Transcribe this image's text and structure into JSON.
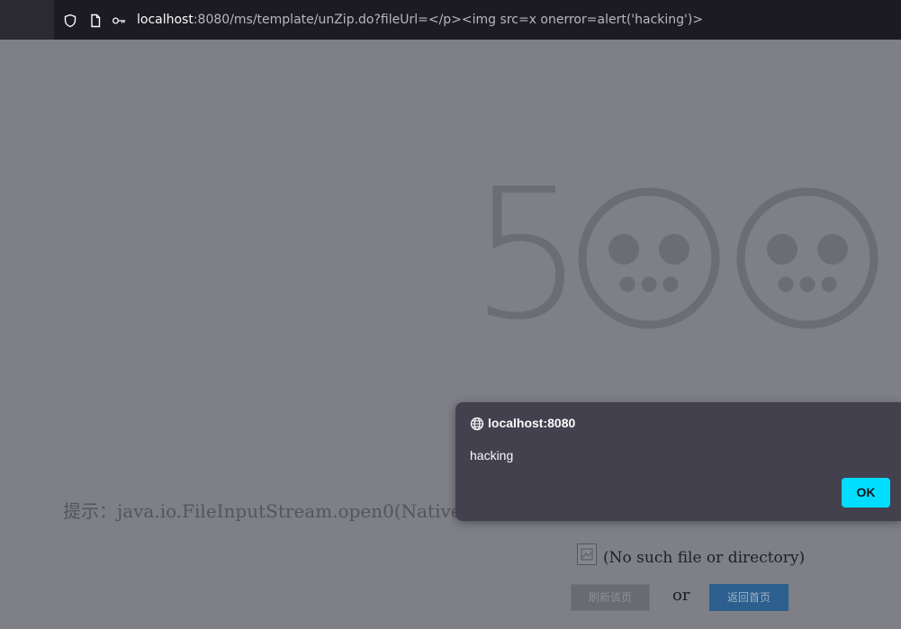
{
  "browser": {
    "url_host": "localhost",
    "url_rest": ":8080/ms/template/unZip.do?fileUrl=</p><img src=x onerror=alert('hacking')>"
  },
  "error_page": {
    "error_code_digit": "5",
    "hint_text": "提示：java.io.FileInputStream.open0(Native M",
    "no_file_text": "(No such file or directory)",
    "refresh_button_label": "刷新该页",
    "or_text": "or",
    "home_button_label": "返回首页"
  },
  "alert_dialog": {
    "origin": "localhost:8080",
    "message": "hacking",
    "ok_label": "OK"
  },
  "colors": {
    "dialog_bg": "#42414d",
    "ok_button": "#00ddff",
    "home_button": "#2c5f8d",
    "page_overlay": "#7e7f87"
  }
}
